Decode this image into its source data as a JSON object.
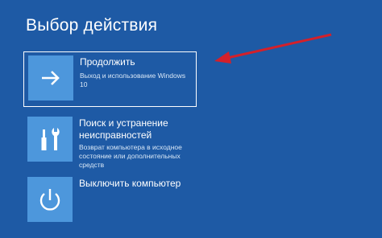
{
  "header": {
    "title": "Выбор действия"
  },
  "options": [
    {
      "title": "Продолжить",
      "description": "Выход и использование Windows 10",
      "icon": "arrow-right-icon",
      "selected": true
    },
    {
      "title": "Поиск и устранение неисправностей",
      "description": "Возврат компьютера в исходное состояние или дополнительных средств",
      "icon": "tools-icon",
      "selected": false
    },
    {
      "title": "Выключить компьютер",
      "description": "",
      "icon": "power-icon",
      "selected": false
    }
  ],
  "colors": {
    "background": "#1e5aa5",
    "tile": "#4d97dc",
    "annotation_arrow": "#d4202a"
  }
}
